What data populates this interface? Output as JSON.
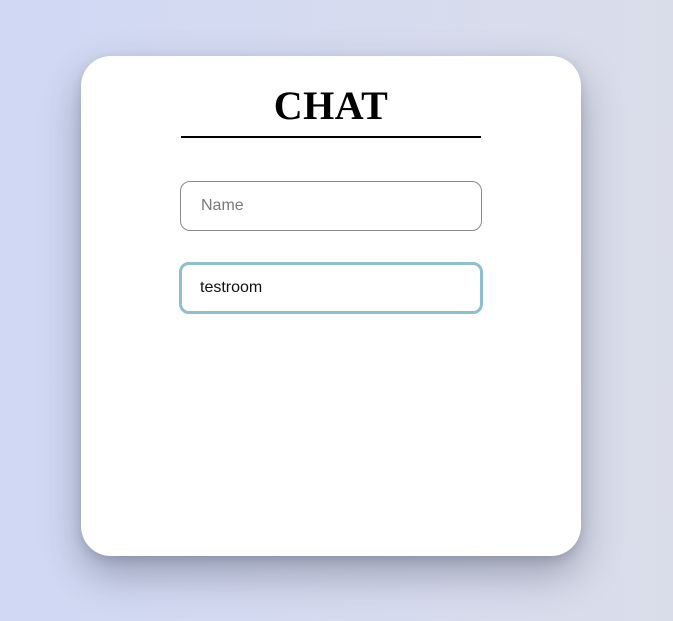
{
  "title": "CHAT",
  "form": {
    "name_field": {
      "placeholder": "Name",
      "value": ""
    },
    "room_field": {
      "placeholder": "",
      "value": "testroom"
    }
  },
  "colors": {
    "card_background": "#ffffff",
    "focus_border": "#8cbfd2",
    "divider": "#000000"
  }
}
